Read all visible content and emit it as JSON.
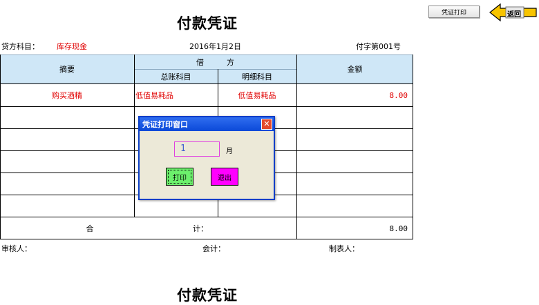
{
  "voucher": {
    "title": "付款凭证",
    "credit_label": "贷方科目：",
    "credit_value": "库存现金",
    "date": "2016年1月2日",
    "number": "付字第001号",
    "headers": {
      "summary": "摘要",
      "debit": "借　　　方",
      "general": "总账科目",
      "detail": "明细科目",
      "amount": "金额"
    },
    "rows": [
      {
        "summary": "购买酒精",
        "general": "低值易耗品",
        "detail": "低值易耗品",
        "amount": "8.00"
      }
    ],
    "total_label_left": "合",
    "total_label_right": "计：",
    "total_amount": "8.00",
    "footer": {
      "reviewer": "审核人：",
      "accountant": "会计：",
      "maker": "制表人："
    }
  },
  "toolbar": {
    "print_label": "凭证打印",
    "back_label": "返回"
  },
  "dialog": {
    "title": "凭证打印窗口",
    "close_glyph": "✕",
    "month_value": "1",
    "month_unit": "月",
    "print_button": "打印",
    "exit_button": "退出"
  },
  "colors": {
    "header_bg": "#cfe7f7",
    "dialog_title": "#0b49d8",
    "print_button": "#6cf06c",
    "exit_button": "#ff00ff",
    "back_arrow": "#f7c400"
  }
}
